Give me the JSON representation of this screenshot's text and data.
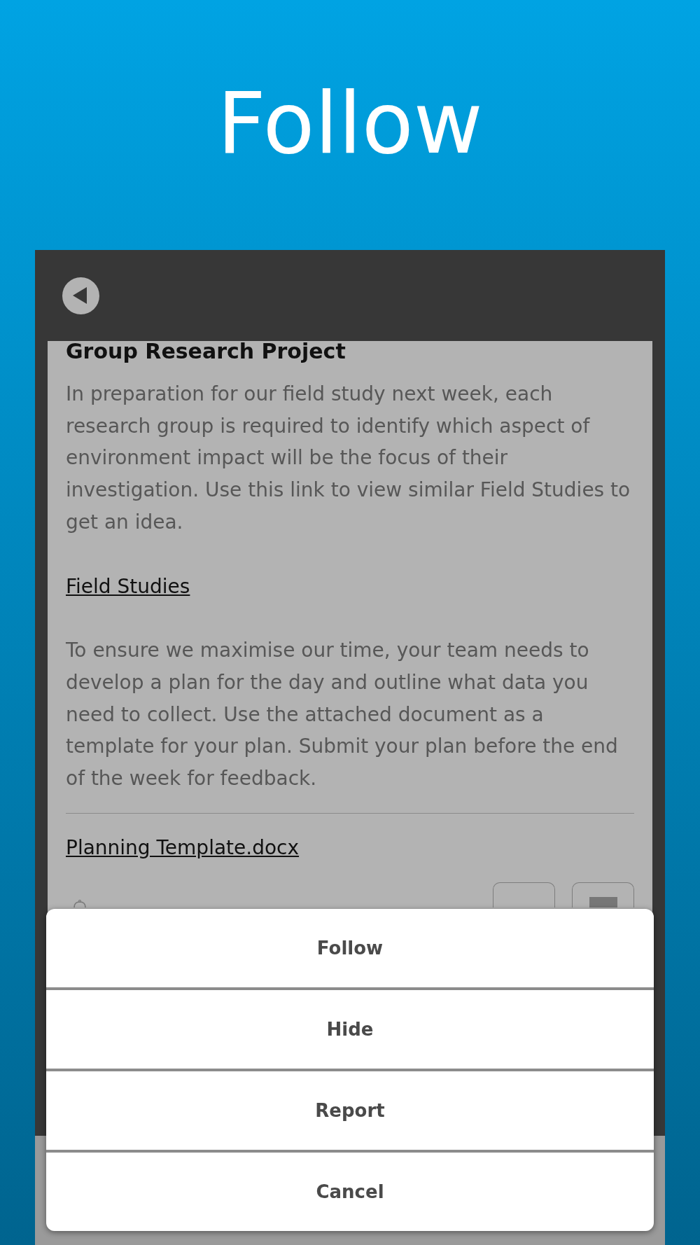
{
  "page_title": "Follow",
  "post": {
    "title": "Group Research Project",
    "blocks": [
      {
        "kind": "text",
        "text": "In preparation for our field study next week, each research group is required to identify which aspect of environment impact will be the focus of their investigation. Use this link to view similar Field Studies to get an idea."
      },
      {
        "kind": "link",
        "text": "Field Studies"
      },
      {
        "kind": "text",
        "text": "To ensure we maximise our time, your team needs to develop a plan for the day and outline what data you need to collect. Use the attached document as a template for your plan. Submit your plan before the end of the week for feedback."
      },
      {
        "kind": "attachment",
        "text": "Planning Template.docx"
      }
    ]
  },
  "action_sheet": {
    "actions": [
      "Follow",
      "Hide",
      "Report",
      "Cancel"
    ]
  }
}
